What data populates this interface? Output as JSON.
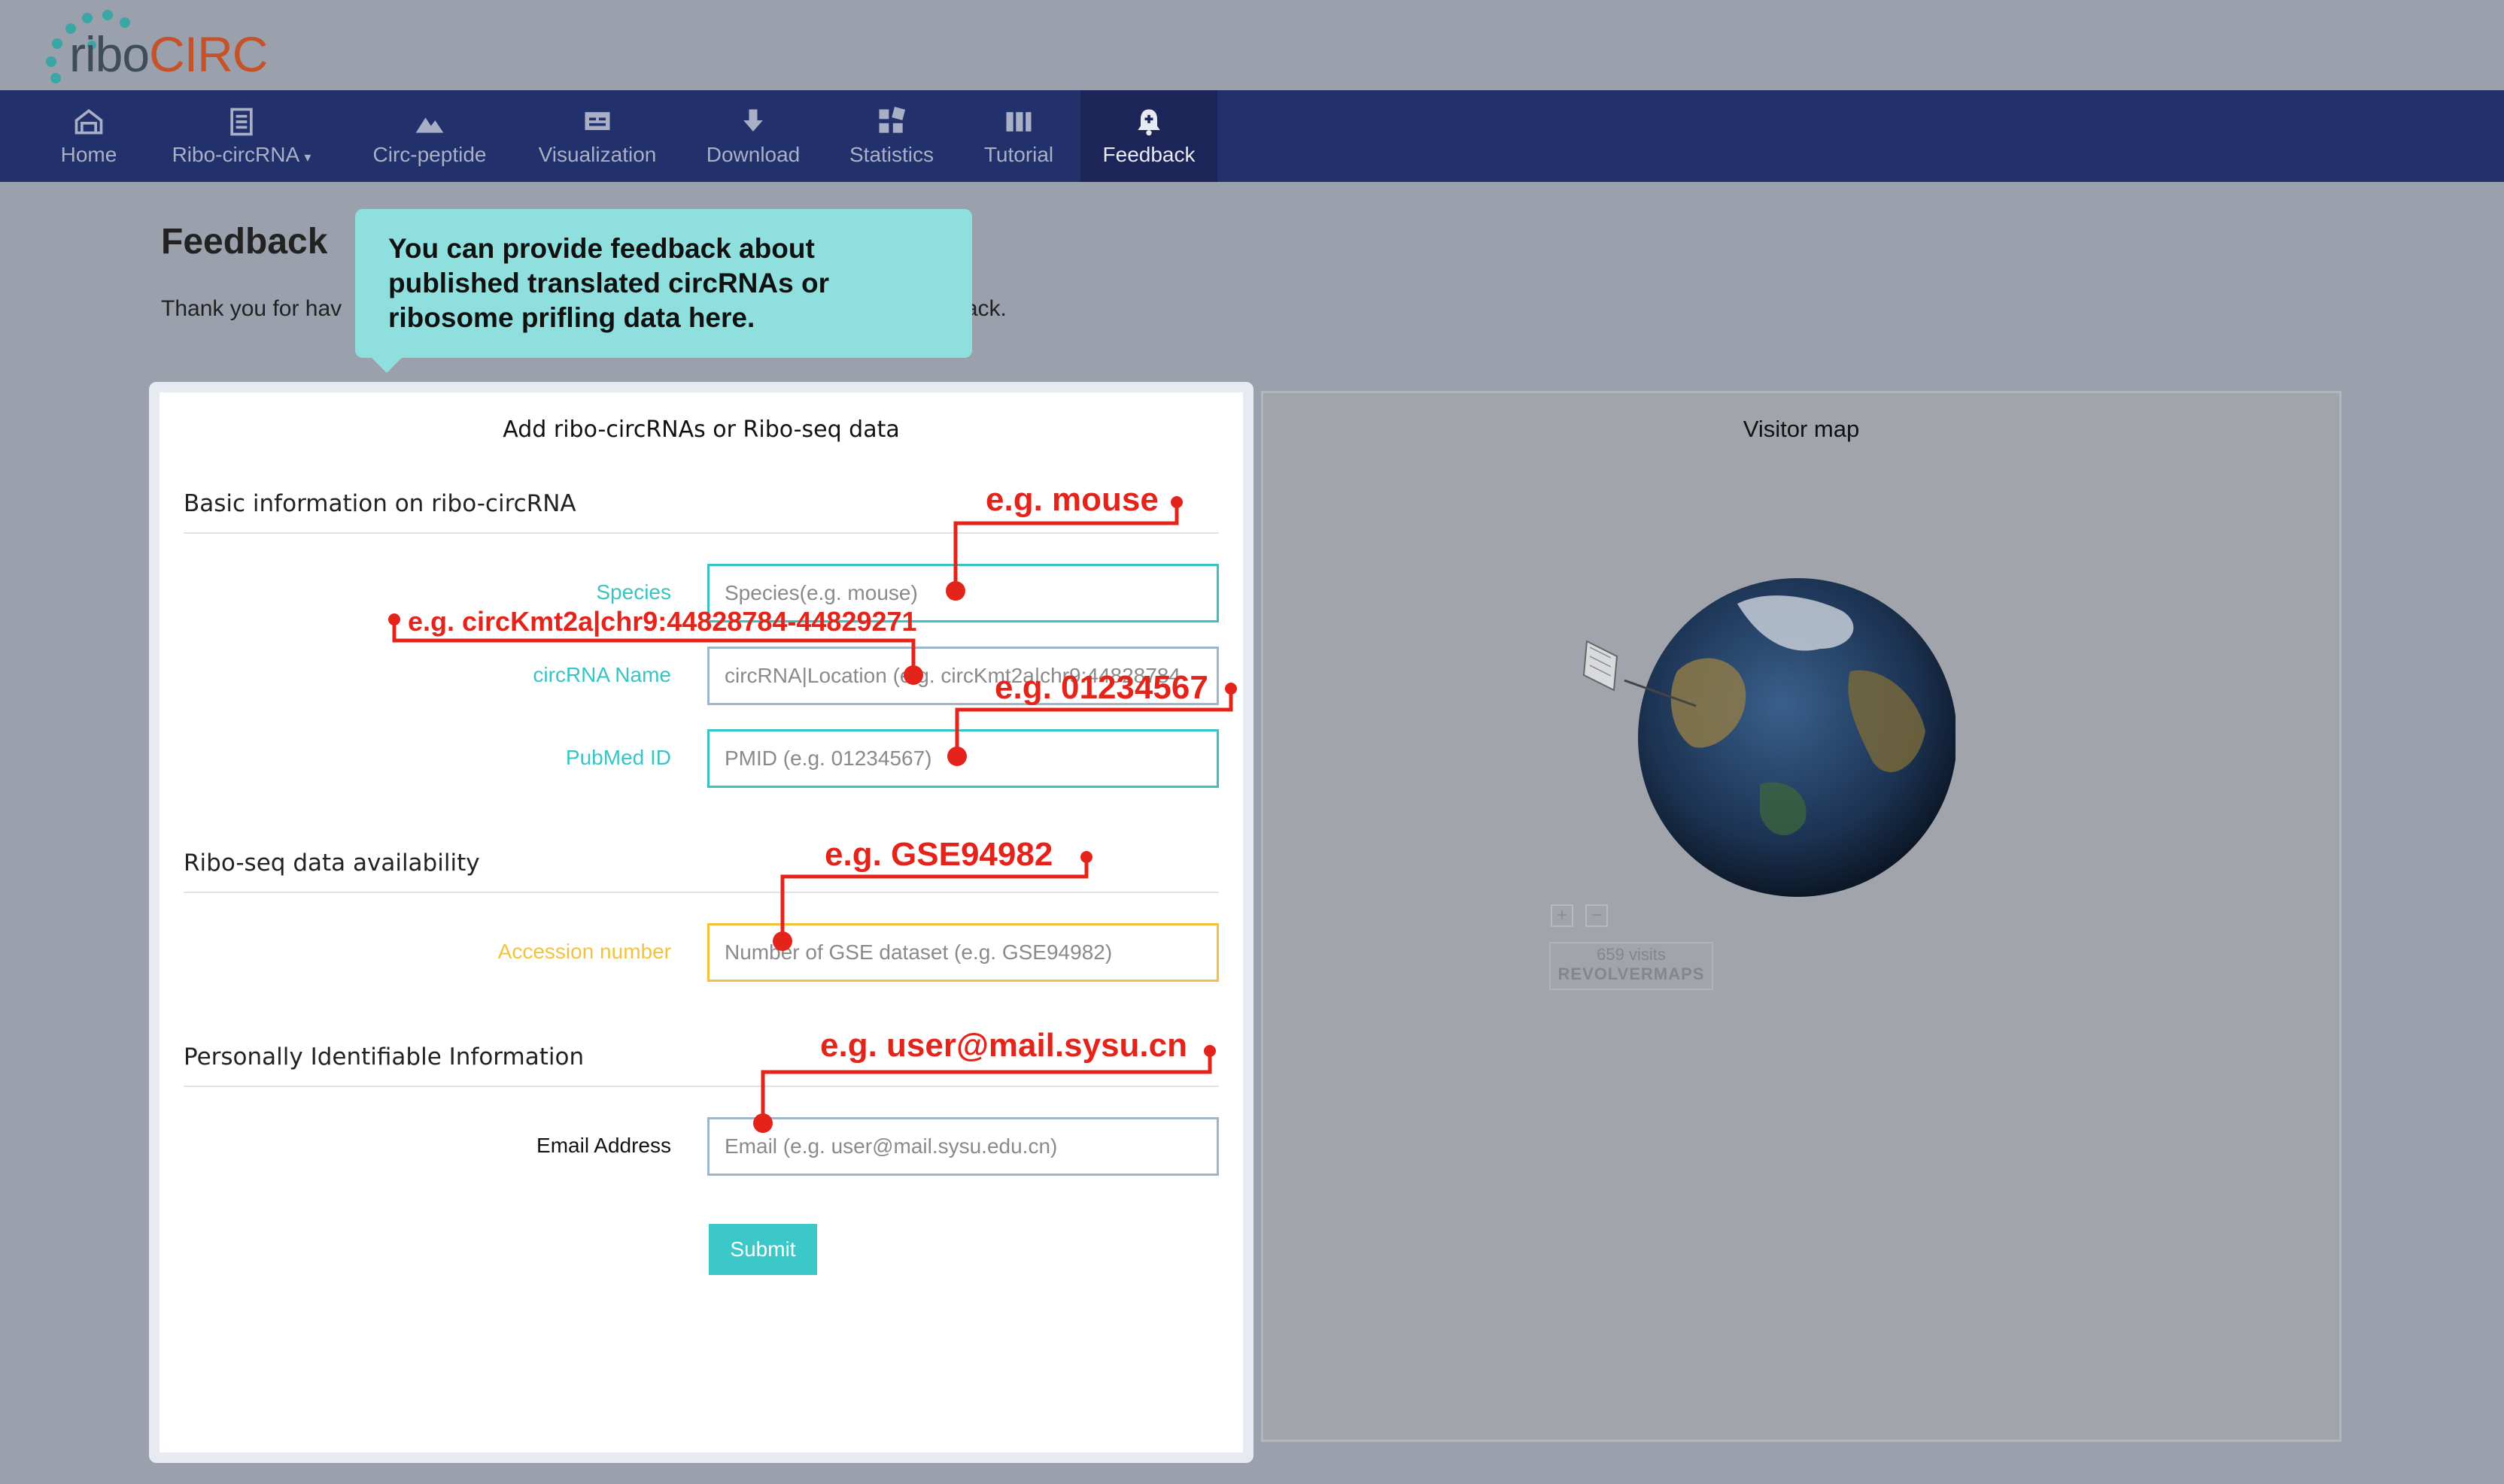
{
  "logo": {
    "part1": "ribo",
    "part2": "CIRC"
  },
  "nav": {
    "items": [
      {
        "label": "Home",
        "icon": "home-icon"
      },
      {
        "label": "Ribo-circRNA",
        "icon": "document-icon",
        "dropdown": true
      },
      {
        "label": "Circ-peptide",
        "icon": "mountain-icon"
      },
      {
        "label": "Visualization",
        "icon": "monitor-icon"
      },
      {
        "label": "Download",
        "icon": "download-icon"
      },
      {
        "label": "Statistics",
        "icon": "grid-icon"
      },
      {
        "label": "Tutorial",
        "icon": "columns-icon"
      },
      {
        "label": "Feedback",
        "icon": "bell-plus-icon",
        "active": true
      }
    ]
  },
  "page": {
    "title": "Feedback",
    "intro_left": "Thank you for hav",
    "intro_right": "back."
  },
  "tooltip": {
    "text": "You can provide feedback about published translated circRNAs or ribosome prifling data here."
  },
  "form": {
    "title": "Add ribo-circRNAs or Ribo-seq data",
    "section_basic": "Basic information on ribo-circRNA",
    "section_riboseq": "Ribo-seq data availability",
    "section_personal": "Personally Identifiable Information",
    "species": {
      "label": "Species",
      "placeholder": "Species(e.g. mouse)",
      "label_color": "#38c4c4"
    },
    "circrna": {
      "label": "circRNA Name",
      "placeholder": "circRNA|Location (e.g. circKmt2a|chr9:44828784",
      "label_color": "#38c4c4"
    },
    "pubmed": {
      "label": "PubMed ID",
      "placeholder": "PMID (e.g. 01234567)",
      "label_color": "#38c4c4"
    },
    "accession": {
      "label": "Accession number",
      "placeholder": "Number of GSE dataset (e.g. GSE94982)",
      "label_color": "#f3c23d"
    },
    "email": {
      "label": "Email Address",
      "placeholder": "Email (e.g. user@mail.sysu.edu.cn)",
      "label_color": "#111111"
    },
    "submit_label": "Submit"
  },
  "map": {
    "title": "Visitor map",
    "zoom_in": "+",
    "zoom_out": "−",
    "visits": "659 visits",
    "brand": "REVOLVERMAPS"
  },
  "annotations": {
    "species": "e.g. mouse",
    "circrna": "e.g. circKmt2a|chr9:44828784-44829271",
    "pubmed": "e.g. 01234567",
    "accession": "e.g. GSE94982",
    "email": "e.g. user@mail.sysu.cn",
    "color": "#e4241b"
  }
}
